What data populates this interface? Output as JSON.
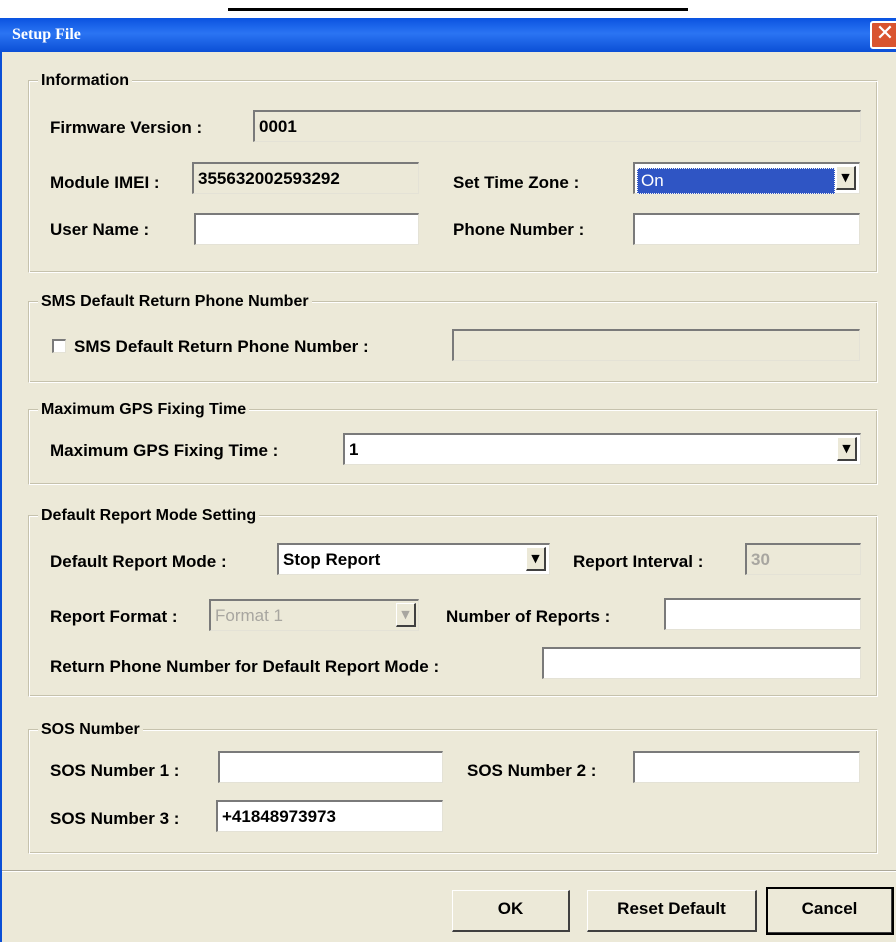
{
  "window": {
    "title": "Setup File",
    "close_glyph": "✕"
  },
  "information": {
    "legend": "Information",
    "firmware_label": "Firmware Version :",
    "firmware_value": "0001",
    "imei_label": "Module IMEI :",
    "imei_value": "355632002593292",
    "timezone_label": "Set Time Zone :",
    "timezone_value": "On",
    "username_label": "User Name :",
    "username_value": "",
    "phone_label": "Phone Number :",
    "phone_value": ""
  },
  "sms": {
    "legend": "SMS Default Return Phone Number",
    "checkbox_label": "SMS Default Return Phone Number :",
    "checked": false,
    "value": ""
  },
  "gps": {
    "legend": "Maximum GPS Fixing Time",
    "label": "Maximum GPS Fixing Time :",
    "value": "1"
  },
  "report": {
    "legend": "Default Report Mode Setting",
    "mode_label": "Default Report Mode :",
    "mode_value": "Stop Report",
    "interval_label": "Report Interval :",
    "interval_value": "30",
    "format_label": "Report Format :",
    "format_value": "Format 1",
    "count_label": "Number of Reports :",
    "count_value": "",
    "return_label": "Return Phone Number for Default Report Mode :",
    "return_value": ""
  },
  "sos": {
    "legend": "SOS Number",
    "sos1_label": "SOS Number 1 :",
    "sos1_value": "",
    "sos2_label": "SOS Number 2 :",
    "sos2_value": "",
    "sos3_label": "SOS Number 3 :",
    "sos3_value": "+41848973973"
  },
  "buttons": {
    "ok": "OK",
    "reset": "Reset Default",
    "cancel": "Cancel"
  },
  "icons": {
    "dropdown": "▼"
  }
}
